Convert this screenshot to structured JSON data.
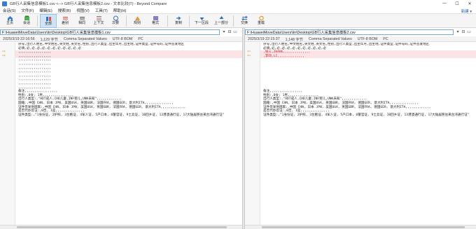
{
  "window": {
    "title": "GB行人采集信息模板1.csv <--> GB行人采集信息模板2.csv - 文本比较(T) - Beyond Compare",
    "minimize": "—",
    "maximize": "☐",
    "close": "✕"
  },
  "menu": {
    "items": [
      "会话(S)",
      "文件(F)",
      "编辑(E)",
      "搜索(R)",
      "视图(V)",
      "工具(T)",
      "帮助(H)"
    ],
    "help_link": "新建 ▾"
  },
  "toolbar": {
    "items": [
      {
        "label": "主页",
        "icon": "home-icon"
      },
      {
        "label": "会话",
        "icon": "session-icon"
      },
      {
        "label": "全部",
        "icon": "all-icon"
      },
      {
        "label": "差别",
        "icon": "diff-icon"
      },
      {
        "label": "相同",
        "icon": "same-icon"
      },
      {
        "label": "上下文",
        "icon": "context-icon"
      },
      {
        "label": "次要",
        "icon": "minor-icon"
      },
      {
        "label": "规则",
        "icon": "rules-icon"
      },
      {
        "label": "格式",
        "icon": "format-icon"
      },
      {
        "label": "复制",
        "icon": "copy-icon"
      },
      {
        "label": "下一区段",
        "icon": "next-section-icon"
      },
      {
        "label": "上一部分",
        "icon": "prev-section-icon"
      },
      {
        "label": "交换",
        "icon": "swap-icon"
      },
      {
        "label": "重载",
        "icon": "reload-icon"
      }
    ],
    "active": "全部"
  },
  "left": {
    "path": "F:\\HuaweiMoveData\\Users\\lin\\Desktop\\GB行人采集信息模板1.csv",
    "info": {
      "datetime": "2025/3/19 22:16:56",
      "size": "1,129 字节",
      "format": "Comma Separated Values",
      "encoding": "UTF-8 BOM",
      "eol": "PC"
    }
  },
  "right": {
    "path": "F:\\HuaweiMoveData\\Users\\lin\\Desktop\\GB行人采集信息模板2.csv",
    "info": {
      "datetime": "2025/3/19 22:15:37",
      "size": "1,148 字节",
      "format": "Comma Separated Values",
      "encoding": "UTF-8 BOM",
      "eol": "PC"
    }
  },
  "left_lines": [
    "序号,出行人姓名,中文姓名,英文姓,英文名,性别,出行人类型,出生年月,出生地,证件类型,证件号码,证件签发地区",
    "必填,必,必,必,必,必,必,必,必,必,必,必",
    ",,,,,,,,,,,,,,,,,",
    ",,,,,,,,,,,,,,,,,",
    ",,,,,,,,,,,,,,,,,",
    ",,,,,,,,,,,,,,,,,",
    ",,,,,,,,,,,,,,,,,",
    ",,,,,,,,,,,,,,,,,",
    ",,,,,,,,,,,,,,,,,",
    ",,,,,,,,,,,,,,,,,",
    ",,,,,,,,,,,,,,,,,",
    ",,,,,,,,,,,,,,,,,",
    "备注,,,,,,,,,,,,,,,,,",
    "性别:,0女; 1男,,,,,,,,,,,,,,,,",
    "出行人类型:,\"ADT成人,CHD儿童,INF婴儿,UNK未知\",,,,,,,,,,,,,",
    "国籍:,中国 CHN, 日本 JPN, 美国USA, 英国GBR, 法国FRA, 德国GER, 意大利ITA,,,,,,,,,,,,,,,",
    "证件签发地国家:,中国 CHN, 日本 JPN, 美国USA, 英国GBR, 法国FRA, 德国GER, 意大利ITA,,,,,,,,,,,,,",
    "是否代办签证:,0否, 1是,,,,,,,,,,,,,,,",
    "证件类型:,\"1身份证, 2护照, 3台胞证, 4军人证, 5户口本, 6警官证, 9士兵证, 10回乡证, 13港澳通行证, 17大陆居民往来台湾通行证\""
  ],
  "right_lines": [
    "序号,出行人姓名,中文姓名,英文姓,英文名,性别,出行人类型,出生年月,出生地,证件类型,证件号码,证件签发地区",
    "必填,必,必,必,必,必,必,必,必,必,必,必",
    ",张三,ZHANG,,,,,,,,,,,,,,",
    ",李四,LI,,,,,,,,,,,,,,",
    "",
    "",
    "",
    "",
    "",
    "",
    "",
    "",
    "备注,,,,,,,,,,,,,,,,,",
    "性别:,0女; 1男,,,,,,,,,,,,,,,,",
    "出行人类型:,\"ADT成人,CHD儿童,INF婴儿,UNK未知\",,,,,,,,,,,,,",
    "国籍:,中国 CHN, 日本 JPN, 美国USA, 英国GBR, 法国FRA, 德国GER, 意大利ITA,,,,,,,,,,,,,,,",
    "证件签发地国家:,中国 CHN, 日本 JPN, 美国USA, 英国GBR, 法国FRA, 德国GER, 意大利ITA,,,,,,,,,,,,,",
    "是否代办签证:,0否, 1是,,,,,,,,,,,,,,,",
    "证件类型:,\"1身份证, 2护照, 3台胞证, 4军人证, 5户口本, 6警官证, 9士兵证, 10回乡证, 13港澳通行证, 17大陆居民往来台湾通行证\""
  ],
  "colors": {
    "diff_bg": "#fbe3e6",
    "diff_text": "#d21b1b",
    "arrow": "#d98a17",
    "active_tab": "#cfe3f7"
  }
}
